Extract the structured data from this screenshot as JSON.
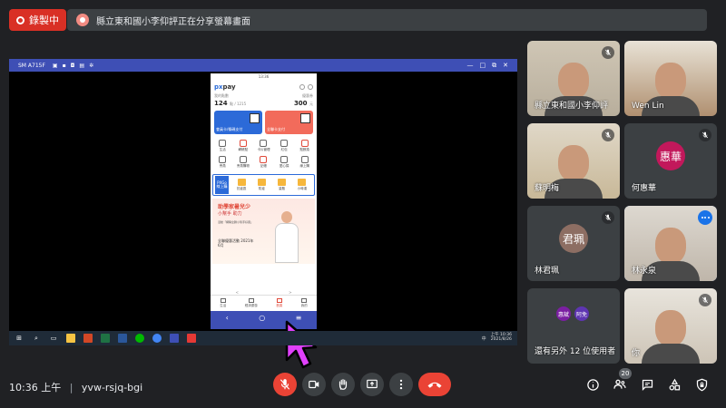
{
  "recording": {
    "label": "錄製中"
  },
  "share_banner": {
    "text": "縣立東和國小李仰評正在分享螢幕畫面"
  },
  "shared_window": {
    "title": "SM A715F",
    "phone": {
      "status_time": "13:36",
      "app_logo_prefix": "px",
      "app_logo_suffix": "pay",
      "points_label": "我的點數",
      "points_value": "124",
      "points_unit": "點 / 1215",
      "coupon_label": "優惠券",
      "coupon_value": "300",
      "coupon_unit": "元",
      "card_blue": "會員卡/條碼支付",
      "card_red": "全聯卡支付",
      "grid": [
        "生活",
        "轉帳點",
        "卡片管理",
        "紅包",
        "點數換",
        "會員",
        "會員購物",
        "記帳",
        "愛心捐",
        "線上購"
      ],
      "promo_tag": "PXGo 線上購",
      "promo_items": [
        "抗疫區",
        "防疫",
        "量販",
        "小時達"
      ],
      "banner_title": "助學家暑兒少",
      "banner_sub": "小幫手 助力",
      "banner_small": "活動「網購全聯小幫手好康」",
      "banner_note": "全聯優惠活動 2021年6月",
      "tabs": [
        "生活",
        "經濟優惠",
        "首頁",
        "我的"
      ],
      "hint": [
        "<",
        ">"
      ],
      "nav": [
        "‹",
        "○",
        "≡"
      ]
    },
    "taskbar": {
      "clock_time": "上午 10:36",
      "clock_date": "2021/8/26",
      "ime": "中"
    }
  },
  "participants": [
    {
      "name": "縣立東和國小李仰評",
      "type": "photo"
    },
    {
      "name": "Wen Lin",
      "type": "photo"
    },
    {
      "name": "蘇明梅",
      "type": "photo"
    },
    {
      "name": "何惠華",
      "type": "avatar",
      "initial": "惠華",
      "color": "#c2185b"
    },
    {
      "name": "林君珮",
      "type": "avatar",
      "initial": "君珮",
      "color": "#8d6e63"
    },
    {
      "name": "林永泉",
      "type": "photo"
    },
    {
      "name": "還有另外 12 位使用者",
      "type": "others",
      "initials": [
        "惠斌",
        "阿免"
      ],
      "colors": [
        "#7b1fa2",
        "#5e35b1"
      ]
    },
    {
      "name": "你",
      "type": "photo"
    }
  ],
  "bottom_bar": {
    "time": "10:36 上午",
    "separator": "|",
    "meeting_code": "yvw-rsjq-bgi",
    "participant_count": "20"
  },
  "colors": {
    "accent": "#1a73e8",
    "danger": "#ea4335",
    "tile": "#3c4043",
    "bg": "#202124"
  }
}
